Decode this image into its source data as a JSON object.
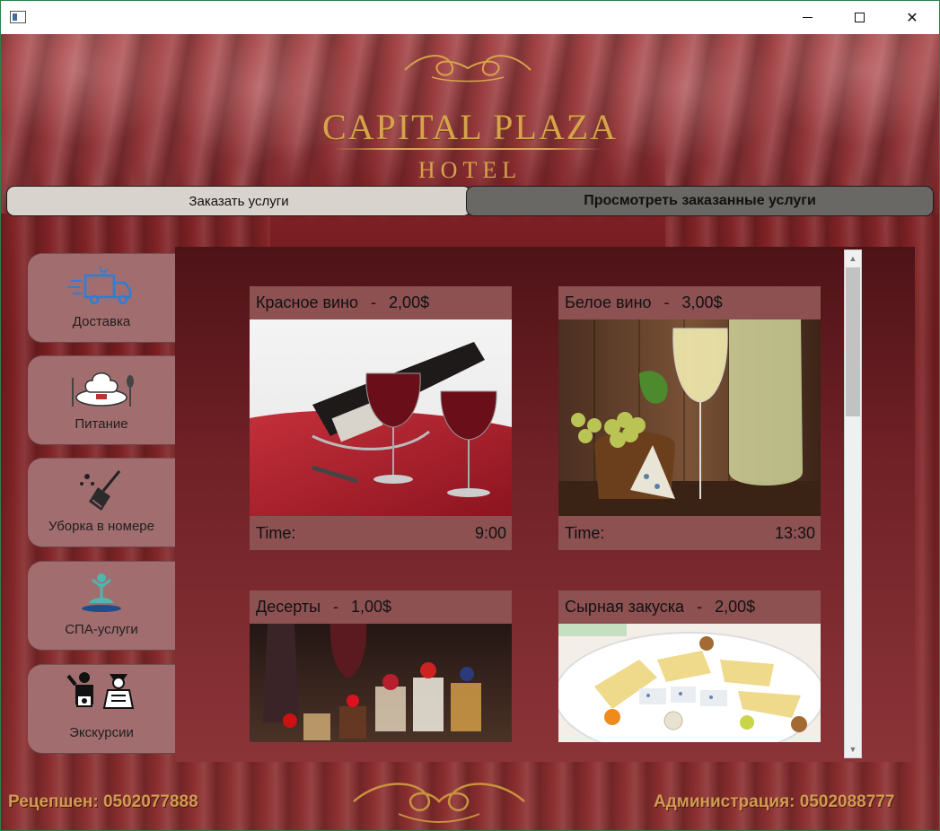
{
  "window": {
    "controls": {
      "minimize": "minimize-icon",
      "maximize": "maximize-icon",
      "close": "close-icon"
    }
  },
  "logo": {
    "title": "CAPITAL PLAZA",
    "subtitle": "HOTEL"
  },
  "tabs": {
    "order_label": "Заказать услуги",
    "view_label": "Просмотреть заказанные услуги"
  },
  "menu": [
    {
      "label": "Доставка",
      "icon": "delivery-truck-icon"
    },
    {
      "label": "Питание",
      "icon": "chef-hat-icon"
    },
    {
      "label": "Уборка в номере",
      "icon": "broom-icon"
    },
    {
      "label": "СПА-услуги",
      "icon": "spa-icon"
    },
    {
      "label": "Экскурсии",
      "icon": "tourist-icon"
    }
  ],
  "orders": [
    {
      "name": "Красное вино",
      "sep": "-",
      "price": "2,00$",
      "time_label": "Time:",
      "time": "9:00",
      "image": "red-wine-image"
    },
    {
      "name": "Белое вино",
      "sep": "-",
      "price": "3,00$",
      "time_label": "Time:",
      "time": "13:30",
      "image": "white-wine-image"
    },
    {
      "name": "Десерты",
      "sep": "-",
      "price": "1,00$",
      "image": "desserts-image"
    },
    {
      "name": "Сырная закуска",
      "sep": "-",
      "price": "2,00$",
      "image": "cheese-plate-image"
    }
  ],
  "footer": {
    "reception": "Рецепшен: 0502077888",
    "administration": "Администрация: 0502088777"
  },
  "colors": {
    "gold": "#d6a44a",
    "curtain": "#8a2a2c",
    "card": "#8d5152",
    "menu": "#a26d6f"
  }
}
